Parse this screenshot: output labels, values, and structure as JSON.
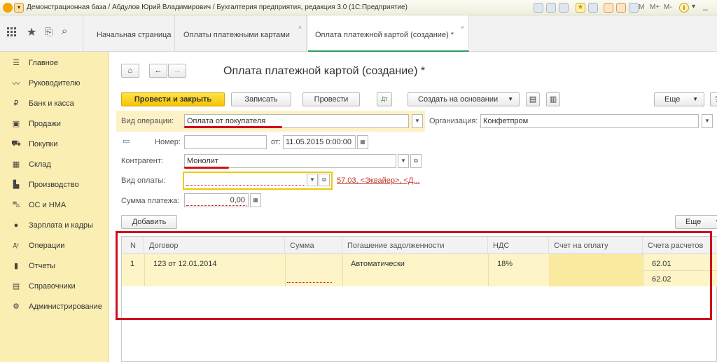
{
  "window": {
    "title": "Демонстрационная база / Абдулов Юрий Владимирович / Бухгалтерия предприятия, редакция 3.0  (1С:Предприятие)",
    "toolbar_right_labels": [
      "M",
      "M+",
      "M-"
    ]
  },
  "tabs": [
    {
      "label": "Начальная страница"
    },
    {
      "label": "Оплаты платежными картами"
    },
    {
      "label": "Оплата платежной картой (создание) *"
    }
  ],
  "sidebar": {
    "items": [
      {
        "label": "Главное",
        "icon": "menu-icon"
      },
      {
        "label": "Руководителю",
        "icon": "trend-icon"
      },
      {
        "label": "Банк и касса",
        "icon": "ruble-icon"
      },
      {
        "label": "Продажи",
        "icon": "bag-icon"
      },
      {
        "label": "Покупки",
        "icon": "cart-icon"
      },
      {
        "label": "Склад",
        "icon": "grid-icon"
      },
      {
        "label": "Производство",
        "icon": "factory-icon"
      },
      {
        "label": "ОС и НМА",
        "icon": "truck-icon"
      },
      {
        "label": "Зарплата и кадры",
        "icon": "person-icon"
      },
      {
        "label": "Операции",
        "icon": "dt-kt-icon"
      },
      {
        "label": "Отчеты",
        "icon": "bar-chart-icon"
      },
      {
        "label": "Справочники",
        "icon": "book-icon"
      },
      {
        "label": "Администрирование",
        "icon": "gear-icon"
      }
    ]
  },
  "form": {
    "title": "Оплата платежной картой (создание) *",
    "buttons": {
      "post_close": "Провести и закрыть",
      "save": "Записать",
      "post": "Провести",
      "create_based": "Создать на основании",
      "more": "Еще",
      "help": "?",
      "add": "Добавить",
      "table_more": "Еще"
    },
    "operation_label": "Вид операции:",
    "operation_value": "Оплата от покупателя",
    "organization_label": "Организация:",
    "organization_value": "Конфетпром",
    "number_label": "Номер:",
    "number_value": "",
    "date_label": "от:",
    "date_value": "11.05.2015  0:00:00",
    "counterparty_label": "Контрагент:",
    "counterparty_value": "Монолит",
    "payment_type_label": "Вид оплаты:",
    "payment_type_value": "",
    "account_link": "57.03, <Эквайер>, <Д...",
    "amount_label": "Сумма платежа:",
    "amount_value": "0,00"
  },
  "table": {
    "columns": [
      "N",
      "Договор",
      "Сумма",
      "Погашение задолженности",
      "НДС",
      "Счет на оплату",
      "Счета расчетов"
    ],
    "rows": [
      {
        "n": "1",
        "contract": "123 от 12.01.2014",
        "amount": "",
        "debt_repayment": "Автоматически",
        "vat": "18%",
        "invoice": "",
        "accounts": [
          "62.01",
          "62.02"
        ]
      }
    ]
  },
  "colors": {
    "sidebar_bg": "#fbeeb3",
    "primary_button": "#f5c400",
    "highlight_red": "#d0101a",
    "active_tab_underline": "#2e9c5c",
    "row_highlight": "#fdf4c8"
  }
}
